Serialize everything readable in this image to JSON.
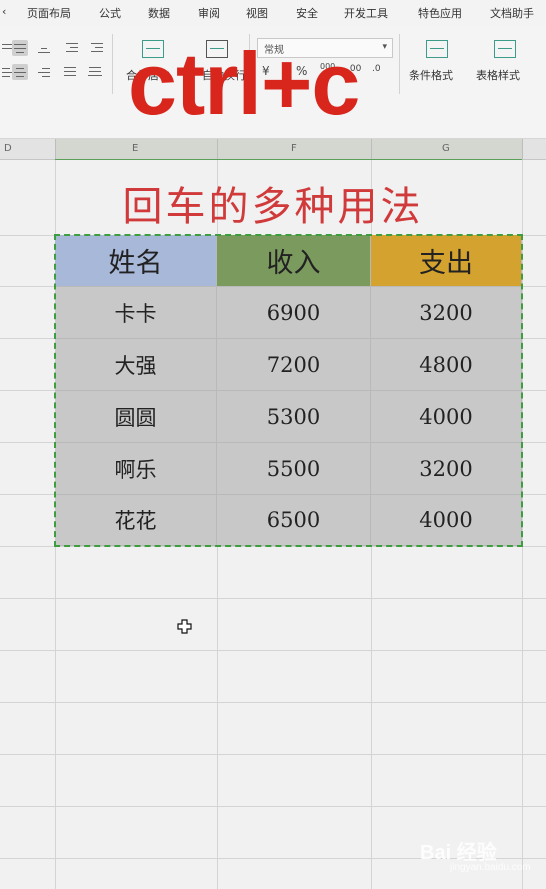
{
  "menu": {
    "items": [
      "页面布局",
      "公式",
      "数据",
      "审阅",
      "视图",
      "安全",
      "开发工具",
      "特色应用",
      "文档助手"
    ]
  },
  "toolbar": {
    "number_format": "常规",
    "merge_label": "合并居中",
    "wrap_label": "自动换行",
    "percent_symbol": "%",
    "thousands_symbol": "000",
    "dec_increase": ".00",
    "dec_decrease": ".0",
    "conditional_format_label": "条件格式",
    "table_style_label": "表格样式"
  },
  "overlay_title": "ctrl+c",
  "column_headers": [
    "D",
    "E",
    "F",
    "G"
  ],
  "sheet": {
    "subtitle": "回车的多种用法",
    "table": {
      "headers": [
        "姓名",
        "收入",
        "支出"
      ],
      "header_colors": [
        "#a8b8d8",
        "#7b9a5e",
        "#d4a22e"
      ],
      "rows": [
        [
          "卡卡",
          "6900",
          "3200"
        ],
        [
          "大强",
          "7200",
          "4800"
        ],
        [
          "圆圆",
          "5300",
          "4000"
        ],
        [
          "啊乐",
          "5500",
          "3200"
        ],
        [
          "花花",
          "6500",
          "4000"
        ]
      ]
    }
  },
  "watermark": {
    "brand": "Bai 经验",
    "url": "jingyan.baidu.com"
  },
  "colors": {
    "overlay_red": "#d8261d",
    "subtitle_red": "#d13a3a",
    "copy_marquee": "#3e9d3e",
    "data_cell_gray": "#c8c8c8"
  }
}
